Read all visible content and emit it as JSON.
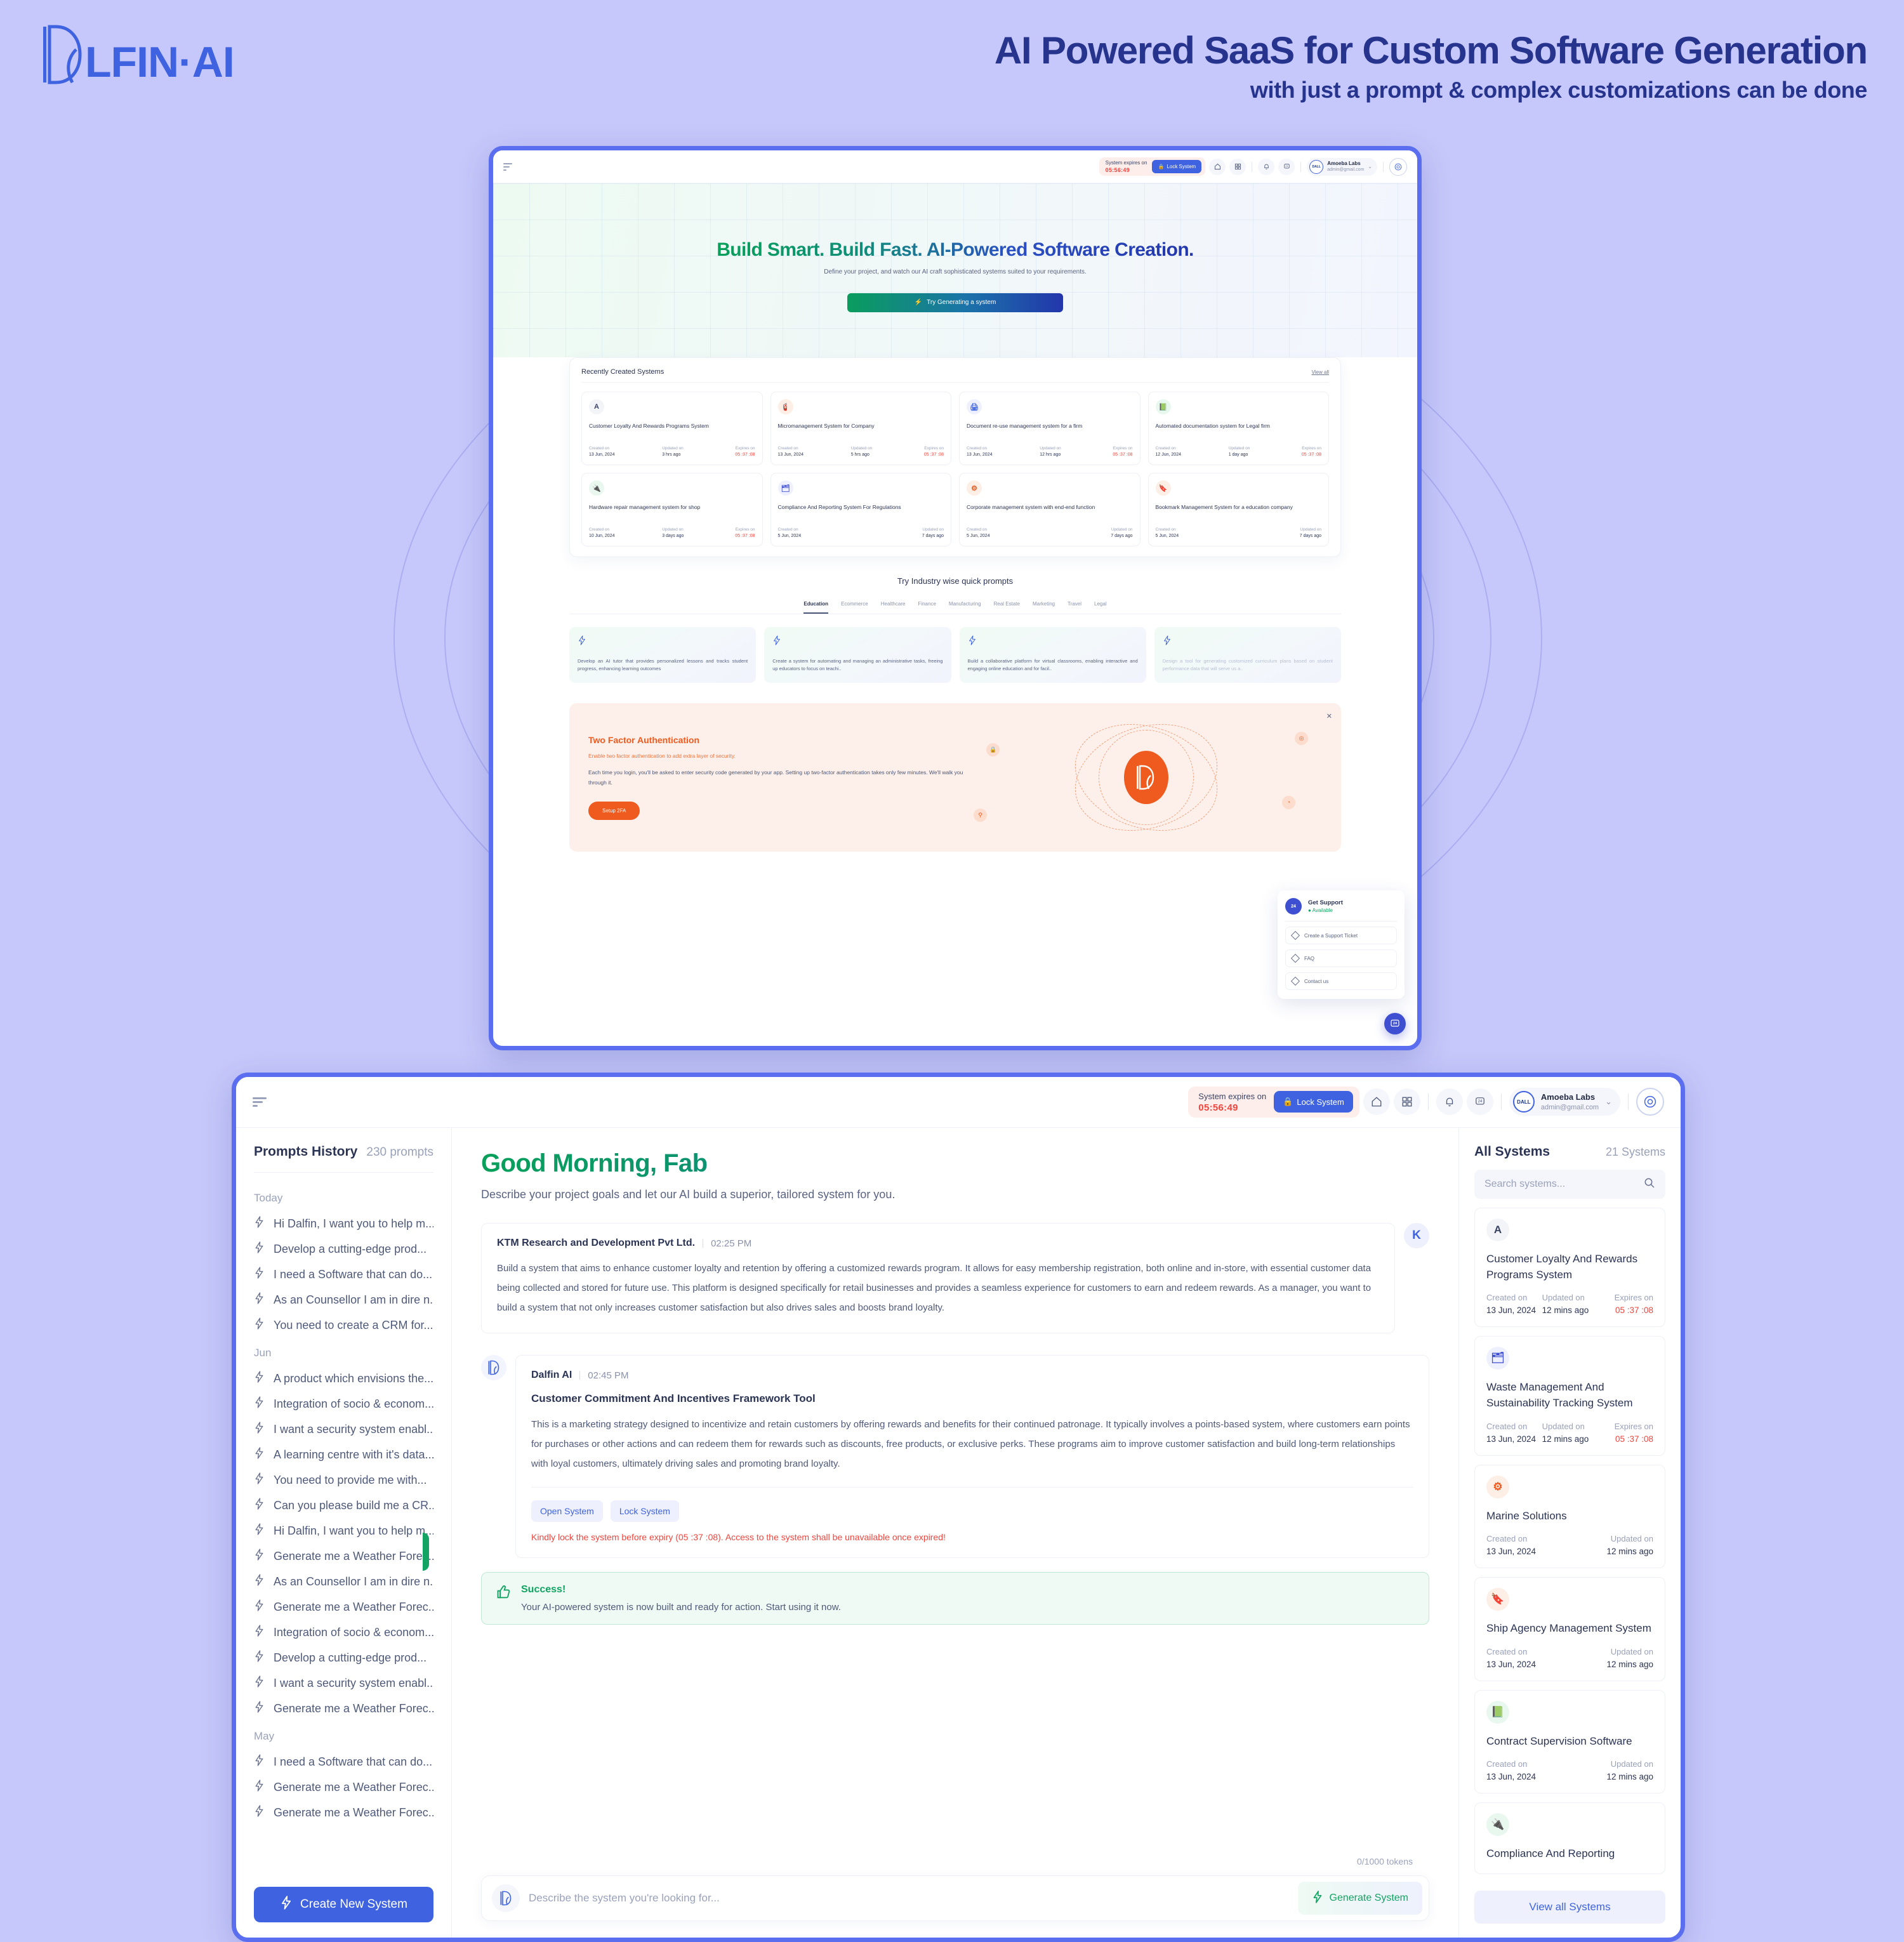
{
  "brand": {
    "word": "LFIN·AI",
    "mark": "dalfin-logo"
  },
  "headline": {
    "title": "AI Powered SaaS for Custom Software Generation",
    "subtitle": "with just a prompt & complex customizations can be done"
  },
  "topbar": {
    "expires_label": "System expires on",
    "expires_time": "05:56:49",
    "lock_label": "Lock System",
    "user_name": "Amoeba Labs",
    "user_email": "admin@gmail.com",
    "avatar_text": "DALL",
    "notif_badge": "24"
  },
  "hero": {
    "title": "Build Smart. Build Fast. AI-Powered Software Creation.",
    "subtitle": "Define your project, and watch our AI craft sophisticated systems suited to your requirements.",
    "cta": "Try Generating a system"
  },
  "recent": {
    "title": "Recently Created Systems",
    "view_all": "View all",
    "labels": {
      "created": "Created on",
      "updated": "Updated on",
      "expires": "Expires on"
    },
    "cards": [
      {
        "icon": "A",
        "icon_bg": "#f3f4f8",
        "icon_color": "#3a4464",
        "title": "Customer Loyalty And Rewards Programs System",
        "created": "13 Jun, 2024",
        "updated": "3 hrs ago",
        "expires": "05 :37 :08"
      },
      {
        "icon": "🧯",
        "icon_bg": "#fdeee6",
        "icon_color": "#ef5a1e",
        "title": "Micromanagement System for Company",
        "created": "13 Jun, 2024",
        "updated": "5 hrs ago",
        "expires": "05 :37 :08"
      },
      {
        "icon": "🖨",
        "icon_bg": "#eef1fd",
        "icon_color": "#3f63e0",
        "title": "Document re-use management system for a firm",
        "created": "13 Jun, 2024",
        "updated": "12 hrs ago",
        "expires": "05 :37 :08"
      },
      {
        "icon": "📗",
        "icon_bg": "#e8f8ef",
        "icon_color": "#13a463",
        "title": "Automated documentation system for Legal firm",
        "created": "12 Jun, 2024",
        "updated": "1 day ago",
        "expires": "05 :37 :08"
      },
      {
        "icon": "🔌",
        "icon_bg": "#e8f8ef",
        "icon_color": "#13a463",
        "title": "Hardware repair management system for shop",
        "created": "10 Jun, 2024",
        "updated": "3 days ago",
        "expires": "05 :37 :08"
      },
      {
        "icon": "🗂",
        "icon_bg": "#eef1fd",
        "icon_color": "#3f4fd1",
        "title": "Compliance And Reporting System For Regulations",
        "created": "5 Jun, 2024",
        "updated": "7 days ago",
        "expires": ""
      },
      {
        "icon": "⚙",
        "icon_bg": "#fdeee6",
        "icon_color": "#ef5a1e",
        "title": "Corporate management system with end-end function",
        "created": "5 Jun, 2024",
        "updated": "7 days ago",
        "expires": ""
      },
      {
        "icon": "🔖",
        "icon_bg": "#fdeee6",
        "icon_color": "#f09167",
        "title": "Bookmark Management System for a education company",
        "created": "5 Jun, 2024",
        "updated": "7 days ago",
        "expires": ""
      }
    ]
  },
  "quick": {
    "title": "Try Industry wise quick prompts",
    "tabs": [
      "Education",
      "Ecommerce",
      "Healthcare",
      "Finance",
      "Manufacturing",
      "Real Estate",
      "Marketing",
      "Travel",
      "Legal"
    ],
    "active_tab": "Education",
    "prompts": [
      "Develop an AI tutor that provides personalized lessons and tracks student progress, enhancing learning outcomes",
      "Create a system for automating and managing an administrative tasks, freeing up educators to focus on teachi..",
      "Build a collaborative platform for virtual classrooms, enabling interactive and engaging online education and for facil..",
      "Design a tool for generating customized curriculum plans based on student performance data that will serve us a.."
    ]
  },
  "twofa": {
    "title": "Two Factor Authentication",
    "subtitle": "Enable two factor authentication to add extra layer of security.",
    "body": "Each time you login, you'll be asked to enter security code generated by your app. Setting up two-factor authentication takes only few minutes. We'll walk you through it.",
    "button": "Setup 2FA",
    "close": "✕"
  },
  "support": {
    "title": "Get Support",
    "status": "Available",
    "badge": "24",
    "items": [
      "Create a Support Ticket",
      "FAQ",
      "Contact us"
    ]
  },
  "prompts_history": {
    "title": "Prompts History",
    "count": "230 prompts",
    "create_button": "Create New System",
    "groups": [
      {
        "label": "Today",
        "items": [
          "Hi Dalfin, I want you to help m...",
          "Develop a cutting-edge prod...",
          "I need a Software that can do...",
          "As an Counsellor I am in dire n...",
          "You need to create a CRM for..."
        ]
      },
      {
        "label": "Jun",
        "items": [
          "A product which envisions the...",
          "Integration of socio & econom...",
          "I want a security system enabl...",
          "A learning centre with it's data...",
          "You need to provide me with...",
          "Can you please build me a CR...",
          "Hi Dalfin, I want you to help m...",
          "Generate me a Weather Forec...",
          "As an Counsellor I am in dire n...",
          "Generate me a Weather Forec...",
          "Integration of socio & econom...",
          "Develop a cutting-edge prod...",
          "I want a security system enabl...",
          "Generate me a Weather Forec..."
        ]
      },
      {
        "label": "May",
        "items": [
          "I need a Software that can do...",
          "Generate me a Weather Forec...",
          "Generate me a Weather Forec..."
        ]
      }
    ]
  },
  "chat": {
    "greeting": "Good Morning, Fab",
    "greeting_sub": "Describe your project goals and let our AI build a superior, tailored system for you.",
    "user_message": {
      "author": "KTM Research and Development Pvt Ltd.",
      "time": "02:25 PM",
      "avatar": "K",
      "body": "Build a system that aims to enhance customer loyalty and retention by offering a customized rewards program. It allows for easy membership registration, both online and in-store, with essential customer data being collected and stored for future use. This platform is designed specifically for retail businesses and provides a seamless experience for customers to earn and redeem rewards. As a manager, you want to build a system that not only increases customer satisfaction but also drives sales and boosts brand loyalty."
    },
    "ai_message": {
      "author": "Dalfin AI",
      "time": "02:45 PM",
      "title": "Customer Commitment And Incentives Framework Tool",
      "body": "This is a marketing strategy designed to incentivize and retain customers by offering rewards and benefits for their continued patronage. It typically involves a points-based system, where customers earn points for purchases or other actions and can redeem them for rewards such as discounts, free products, or exclusive perks. These programs aim to improve customer satisfaction and build long-term relationships with loyal customers, ultimately driving sales and promoting brand loyalty.",
      "open_button": "Open System",
      "lock_button": "Lock System",
      "warning": "Kindly lock the system before expiry (05 :37 :08). Access to the system shall be unavailable once expired!"
    },
    "success": {
      "title": "Success!",
      "body": "Your AI-powered system is now built and ready for action. Start using it now."
    },
    "tokens": "0/1000 tokens",
    "composer_placeholder": "Describe the system you're looking for...",
    "generate_button": "Generate System"
  },
  "all_systems": {
    "title": "All Systems",
    "count": "21 Systems",
    "search_placeholder": "Search systems...",
    "view_all_button": "View all Systems",
    "labels": {
      "created": "Created on",
      "updated": "Updated on",
      "expires": "Expires on"
    },
    "cards": [
      {
        "icon": "A",
        "icon_bg": "#f3f4f8",
        "icon_color": "#3a4464",
        "title": "Customer Loyalty And Rewards Programs System",
        "created": "13 Jun, 2024",
        "updated": "12 mins ago",
        "expires": "05 :37 :08"
      },
      {
        "icon": "🗂",
        "icon_bg": "#eef1fd",
        "icon_color": "#3f4fd1",
        "title": "Waste Management And Sustainability Tracking System",
        "created": "13 Jun, 2024",
        "updated": "12 mins ago",
        "expires": "05 :37 :08"
      },
      {
        "icon": "⚙",
        "icon_bg": "#fdeee6",
        "icon_color": "#ef5a1e",
        "title": "Marine Solutions",
        "created": "13 Jun, 2024",
        "updated": "12 mins ago",
        "expires": ""
      },
      {
        "icon": "🔖",
        "icon_bg": "#fdeee6",
        "icon_color": "#f09167",
        "title": "Ship Agency Management System",
        "created": "13 Jun, 2024",
        "updated": "12 mins ago",
        "expires": ""
      },
      {
        "icon": "📗",
        "icon_bg": "#e8f8ef",
        "icon_color": "#13a463",
        "title": "Contract Supervision Software",
        "created": "13 Jun, 2024",
        "updated": "12 mins ago",
        "expires": ""
      },
      {
        "icon": "🔌",
        "icon_bg": "#e8f8ef",
        "icon_color": "#13a463",
        "title": "Compliance And Reporting",
        "created": "",
        "updated": "",
        "expires": ""
      }
    ]
  },
  "colors": {
    "page_bg": "#c6c8fb",
    "brand_blue": "#3f63e0",
    "deep_navy": "#27348e",
    "accent_orange": "#ef5a1e",
    "success_green": "#13a463",
    "danger_red": "#f0453d"
  }
}
